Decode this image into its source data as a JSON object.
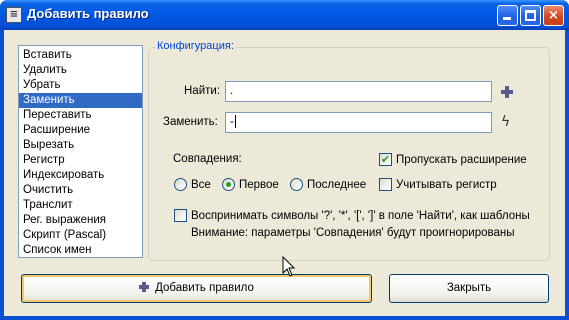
{
  "window": {
    "title": "Добавить правило",
    "icon": "app-icon",
    "controls": {
      "minimize": "minimize-icon",
      "maximize": "maximize-icon",
      "close": "×"
    }
  },
  "rules_list": {
    "items": [
      "Вставить",
      "Удалить",
      "Убрать",
      "Заменить",
      "Переставить",
      "Расширение",
      "Вырезать",
      "Регистр",
      "Индексировать",
      "Очистить",
      "Транслит",
      "Рег. выражения",
      "Скрипт (Pascal)",
      "Список имен"
    ],
    "selected_index": 3
  },
  "config": {
    "legend": "Конфигурация:",
    "find_label": "Найти:",
    "find_value": ".",
    "replace_label": "Заменить:",
    "replace_value": "-",
    "matches_label": "Совпадения:",
    "radio": {
      "all": "Все",
      "first": "Первое",
      "last": "Последнее",
      "selected": "first"
    },
    "skip_extension_label": "Пропускать расширение",
    "skip_extension_checked": true,
    "case_label": "Учитывать регистр",
    "case_checked": false,
    "wildcards_label": "Воспринимать символы '?', '*', '[', ']' в поле 'Найти', как шаблоны",
    "wildcards_checked": false,
    "note": "Внимание: параметры 'Совпадения' будут проигнорированы"
  },
  "buttons": {
    "add_rule": "Добавить правило",
    "close": "Закрыть"
  }
}
